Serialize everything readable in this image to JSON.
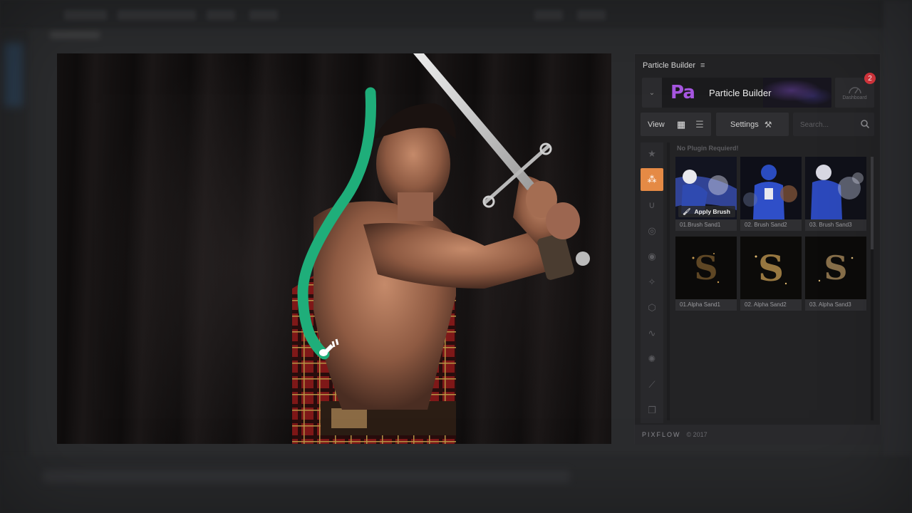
{
  "panel": {
    "title": "Particle Builder",
    "menu_icon": "hamburger-menu-icon",
    "brand": {
      "logo_text": "Pa",
      "name": "Particle Builder",
      "logo_color": "#a656e0"
    },
    "dashboard": {
      "label": "Dashboard",
      "badge": "2",
      "badge_color": "#d9363e"
    },
    "toolbar": {
      "view_label": "View",
      "settings_label": "Settings",
      "search_placeholder": "Search..."
    },
    "side_tools": [
      {
        "name": "favorites-star-icon",
        "active": false
      },
      {
        "name": "particles-dots-icon",
        "active": true
      },
      {
        "name": "magnet-icon",
        "active": false
      },
      {
        "name": "rings-icon",
        "active": false
      },
      {
        "name": "target-icon",
        "active": false
      },
      {
        "name": "magic-wand-icon",
        "active": false
      },
      {
        "name": "cube-icon",
        "active": false
      },
      {
        "name": "wave-icon",
        "active": false
      },
      {
        "name": "explosion-icon",
        "active": false
      },
      {
        "name": "pin-icon",
        "active": false
      },
      {
        "name": "layers-icon",
        "active": false
      }
    ],
    "accent_color": "#e58a45",
    "content": {
      "section_title": "No Plugin Requierd!",
      "apply_label": "Apply Brush",
      "tiles": [
        {
          "label": "01.Brush Sand1",
          "kind": "player"
        },
        {
          "label": "02. Brush Sand2",
          "kind": "player"
        },
        {
          "label": "03. Brush Sand3",
          "kind": "player"
        },
        {
          "label": "01.Alpha Sand1",
          "kind": "dollar"
        },
        {
          "label": "02. Alpha Sand2",
          "kind": "dollar"
        },
        {
          "label": "03. Alpha Sand3",
          "kind": "dollar"
        }
      ]
    },
    "footer": {
      "logo": "PIXFLOW",
      "copyright": "© 2017"
    }
  },
  "canvas": {
    "brush_stroke_color": "#1fae7a"
  }
}
